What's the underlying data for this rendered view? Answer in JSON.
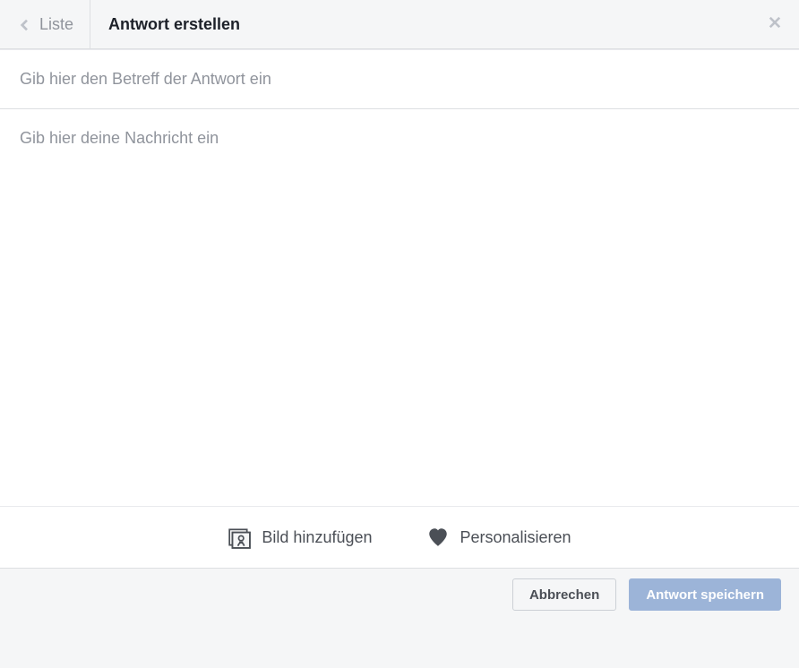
{
  "header": {
    "back_label": "Liste",
    "title": "Antwort erstellen"
  },
  "fields": {
    "subject_placeholder": "Gib hier den Betreff der Antwort ein",
    "subject_value": "",
    "message_placeholder": "Gib hier deine Nachricht ein",
    "message_value": ""
  },
  "toolbar": {
    "add_image_label": "Bild hinzufügen",
    "personalize_label": "Personalisieren"
  },
  "footer": {
    "cancel_label": "Abbrechen",
    "save_label": "Antwort speichern"
  }
}
